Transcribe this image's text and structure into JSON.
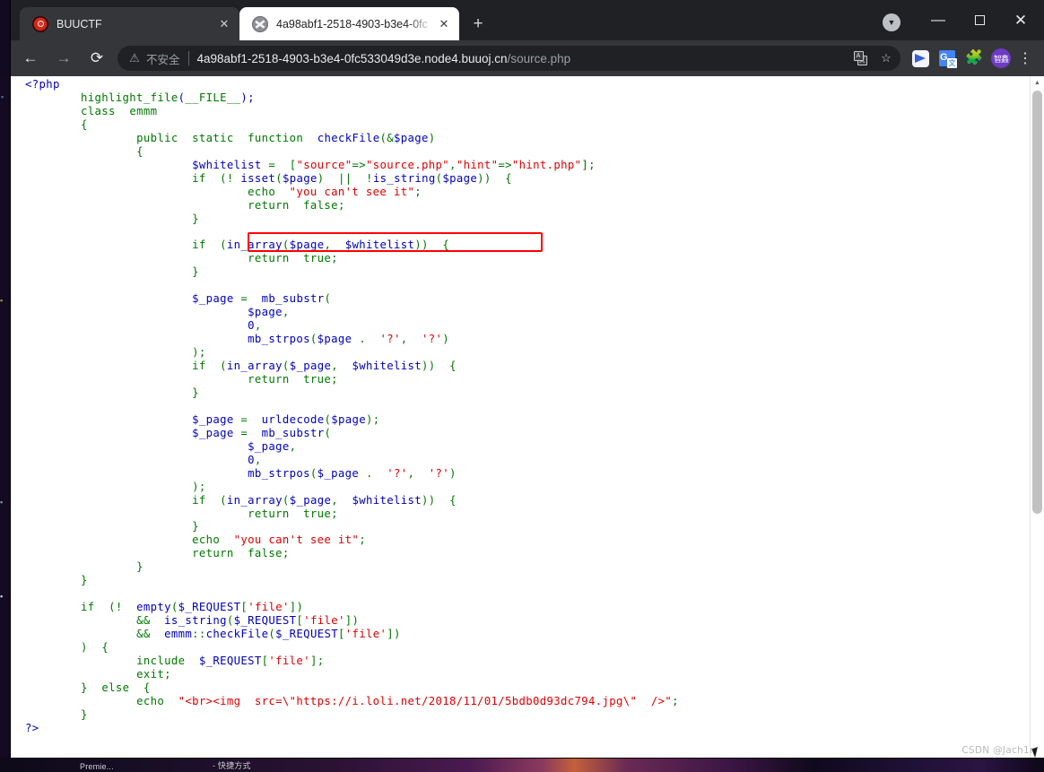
{
  "window": {
    "controls": {
      "minimize": "—",
      "maximize": "",
      "close": "✕",
      "profile_caret": "▼"
    }
  },
  "tabs": [
    {
      "title": "BUUCTF",
      "favicon": "buuctf-shield-icon",
      "close": "✕",
      "active": false
    },
    {
      "title": "4a98abf1-2518-4903-b3e4-0fc",
      "favicon": "globe-icon",
      "close": "✕",
      "active": true
    }
  ],
  "newtab_label": "+",
  "toolbar": {
    "back": "←",
    "forward": "→",
    "reload": "⟳",
    "security_icon": "⚠",
    "security_text": "不安全",
    "url_host": "4a98abf1-2518-4903-b3e4-0fc533049d3e.node4.buuoj.cn",
    "url_path": "/source.php",
    "translate_icon": "translate-icon",
    "bookmark_icon": "☆",
    "extensions": [
      {
        "name": "blue-bird-extension-icon",
        "label": ""
      },
      {
        "name": "google-translate-extension-icon",
        "label": "G"
      },
      {
        "name": "puzzle-extensions-icon",
        "label": "🧩"
      }
    ],
    "avatar_label": "智鑫",
    "menu_icon": "⋮"
  },
  "page": {
    "code": "<?php\n        highlight_file(__FILE__);\n        class emmm\n        {\n                public static function checkFile(&$page)\n                {\n                        $whitelist = [\"source\"=>\"source.php\",\"hint\"=>\"hint.php\"];\n                        if (! isset($page) || !is_string($page)) {\n                                echo \"you can't see it\";\n                                return false;\n                        }\n\n                        if (in_array($page, $whitelist)) {\n                                return true;\n                        }\n\n                        $_page = mb_substr(\n                                $page,\n                                0,\n                                mb_strpos($page . '?', '?')\n                        );\n                        if (in_array($_page, $whitelist)) {\n                                return true;\n                        }\n\n                        $_page = urldecode($page);\n                        $_page = mb_substr(\n                                $_page,\n                                0,\n                                mb_strpos($_page . '?', '?')\n                        );\n                        if (in_array($_page, $whitelist)) {\n                                return true;\n                        }\n                        echo \"you can't see it\";\n                        return false;\n                }\n        }\n\n        if (! empty($_REQUEST['file'])\n                && is_string($_REQUEST['file'])\n                && emmm::checkFile($_REQUEST['file'])\n        ) {\n                include $_REQUEST['file'];\n                exit;\n        } else {\n                echo \"<br><img src=\\\"https://i.loli.net/2018/11/01/5bdb0d93dc794.jpg\\\" />\";\n        }\n?>",
    "highlighted_line": "[\"source\"=>\"source.php\",\"hint\"=>\"hint.php\"];",
    "colors": {
      "default": "#0000bb",
      "keyword": "#007700",
      "string": "#dd0000",
      "comment": "#ff8000",
      "highlight_box": "#ff0000"
    }
  },
  "scrollbar": {
    "up_arrow": "▲"
  },
  "watermark": "CSDN @Jach1n",
  "desktop": {
    "icon_labels": [
      "Premie...",
      "- 快捷方式"
    ]
  }
}
